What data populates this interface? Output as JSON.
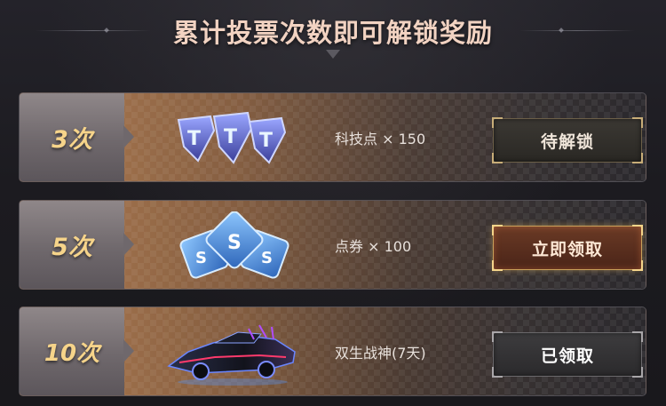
{
  "header": {
    "title": "累计投票次数即可解锁奖励"
  },
  "rewards": [
    {
      "count_label": "3次",
      "reward_label": "科技点 × 150",
      "icon": "tech-point-icon",
      "button_label": "待解锁",
      "button_state": "locked"
    },
    {
      "count_label": "5次",
      "reward_label": "点券 × 100",
      "icon": "coupon-icon",
      "button_label": "立即领取",
      "button_state": "claimable"
    },
    {
      "count_label": "10次",
      "reward_label": "双生战神(7天)",
      "icon": "race-car-icon",
      "button_label": "已领取",
      "button_state": "claimed"
    }
  ],
  "colors": {
    "title": "#f2d3c2",
    "count_text": "#f6d48a",
    "claim_glow": "#f5d58a",
    "row_gradient_start": "#b98255"
  }
}
